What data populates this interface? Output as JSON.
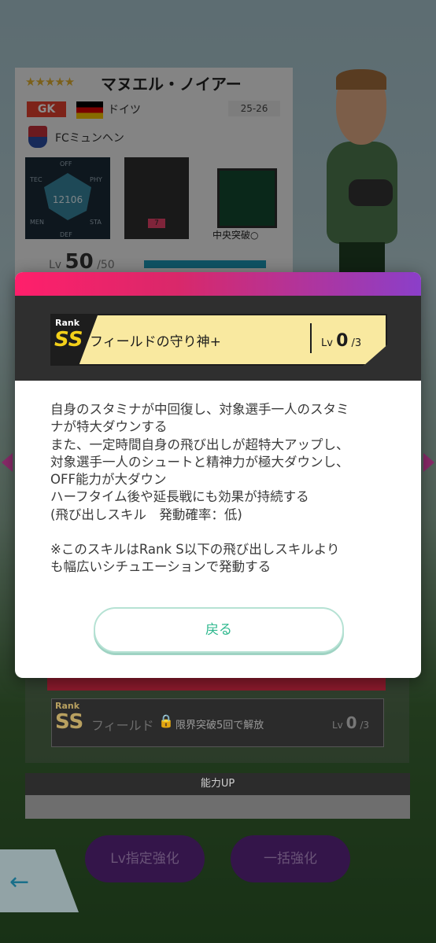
{
  "player": {
    "stars": "★★★★★",
    "name": "マヌエル・ノイアー",
    "position": "GK",
    "country": "ドイツ",
    "season": "25-26",
    "club": "FCミュンヘン",
    "stats_labels": [
      "OFF",
      "TEC",
      "PHY",
      "MEN",
      "STA",
      "DEF"
    ],
    "total_rating": "12106",
    "formation_badge": "7",
    "tactic_label": "中央突破○",
    "level_prefix": "Lv",
    "level": "50",
    "level_max": "/50"
  },
  "modal": {
    "skill": {
      "rank_label": "Rank",
      "rank": "SS",
      "name": "フィールドの守り神+",
      "lv_prefix": "Lv",
      "lv": "0",
      "lv_max": "/3"
    },
    "description": [
      "自身のスタミナが中回復し、対象選手一人のスタミ",
      "ナが特大ダウンする",
      "また、一定時間自身の飛び出しが超特大アップし、",
      "対象選手一人のシュートと精神力が極大ダウンし、",
      "OFF能力が大ダウン",
      "ハーフタイム後や延長戦にも効果が持続する",
      "(飛び出しスキル　発動確率：低)"
    ],
    "note": [
      "※このスキルはRank S以下の飛び出しスキルより",
      "も幅広いシチュエーションで発動する"
    ],
    "return_button": "戻る"
  },
  "background_screen": {
    "skill_row": {
      "rank_label": "Rank",
      "rank": "SS",
      "name": "フィールド",
      "locked_text": "限界突破5回で解放",
      "lv_prefix": "Lv",
      "lv": "0",
      "lv_max": "/3"
    },
    "section_title": "能力UP",
    "buttons": {
      "level_enhance": "Lv指定強化",
      "bulk_enhance": "一括強化"
    },
    "back_icon": "arrow-left-icon"
  }
}
